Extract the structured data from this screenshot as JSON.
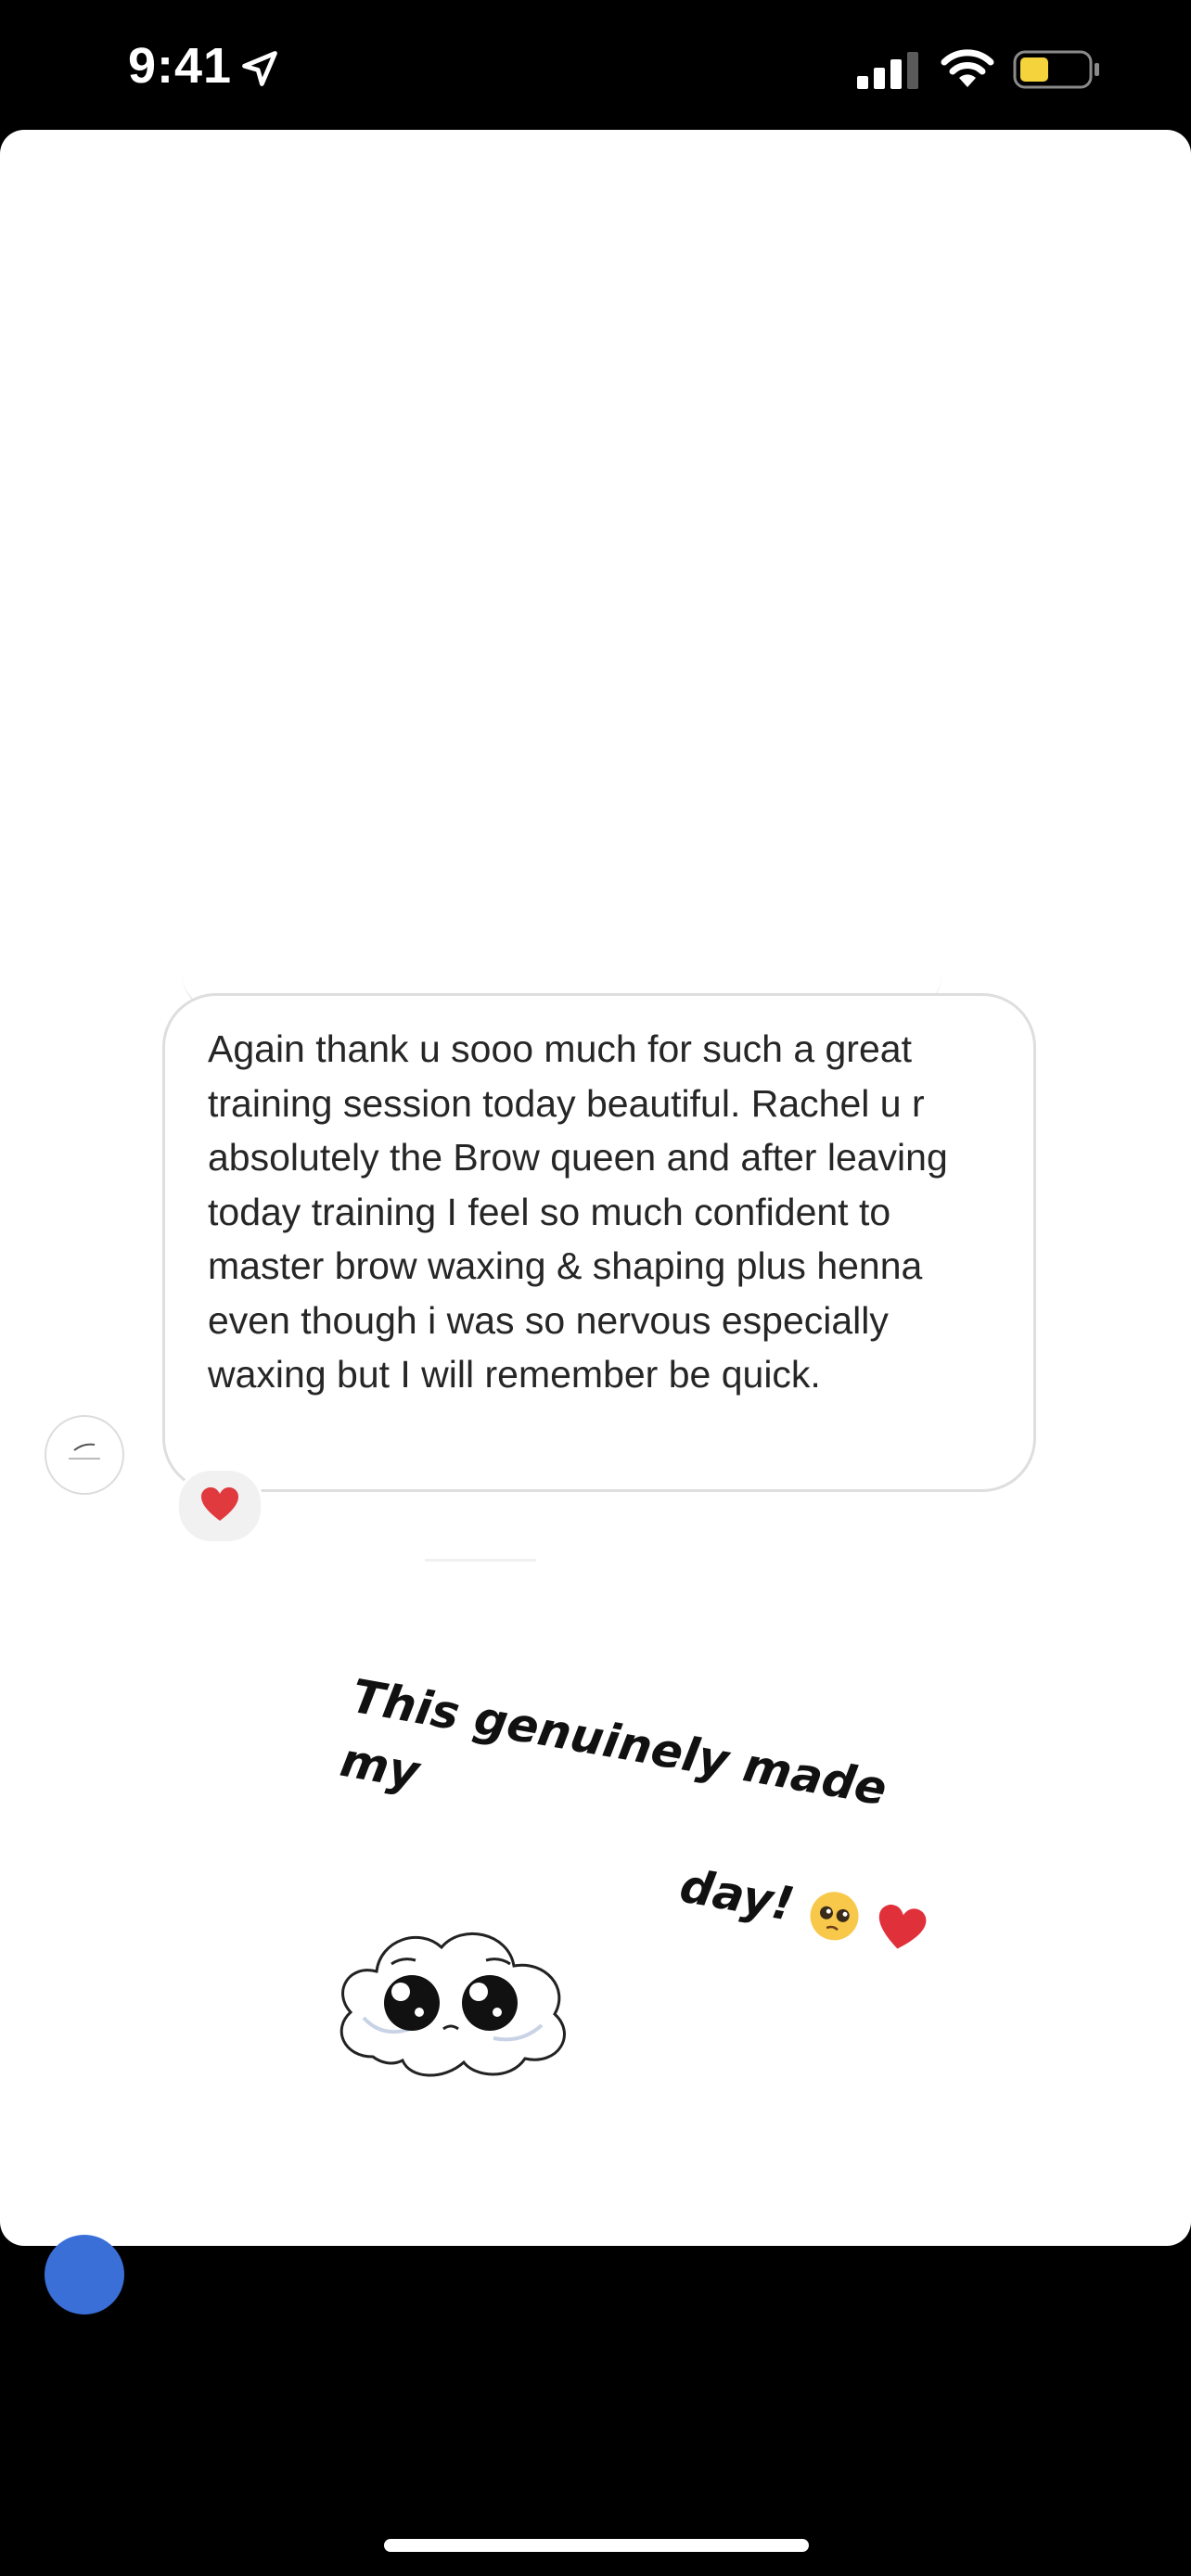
{
  "status_bar": {
    "time": "9:41",
    "location_icon": "location-arrow-icon",
    "signal_icon": "cellular-signal-icon",
    "wifi_icon": "wifi-icon",
    "battery_icon": "battery-icon",
    "battery_color": "#f5d33c"
  },
  "message": {
    "text": "Again thank u sooo much for such a great training session today beautiful. Rachel u r absolutely the Brow queen and after leaving today training I feel so much confident to master brow waxing & shaping plus henna even though i was so nervous especially waxing but I will remember be quick.",
    "reaction": "heart-reaction-icon",
    "reaction_color": "#e0393e",
    "avatar": "sender-avatar"
  },
  "sticker": {
    "line1": "This genuinely made my",
    "line2": "day!",
    "emojis": [
      "pleading-face-emoji",
      "red-heart-emoji"
    ],
    "cloud_icon": "pleading-cloud-sticker"
  }
}
